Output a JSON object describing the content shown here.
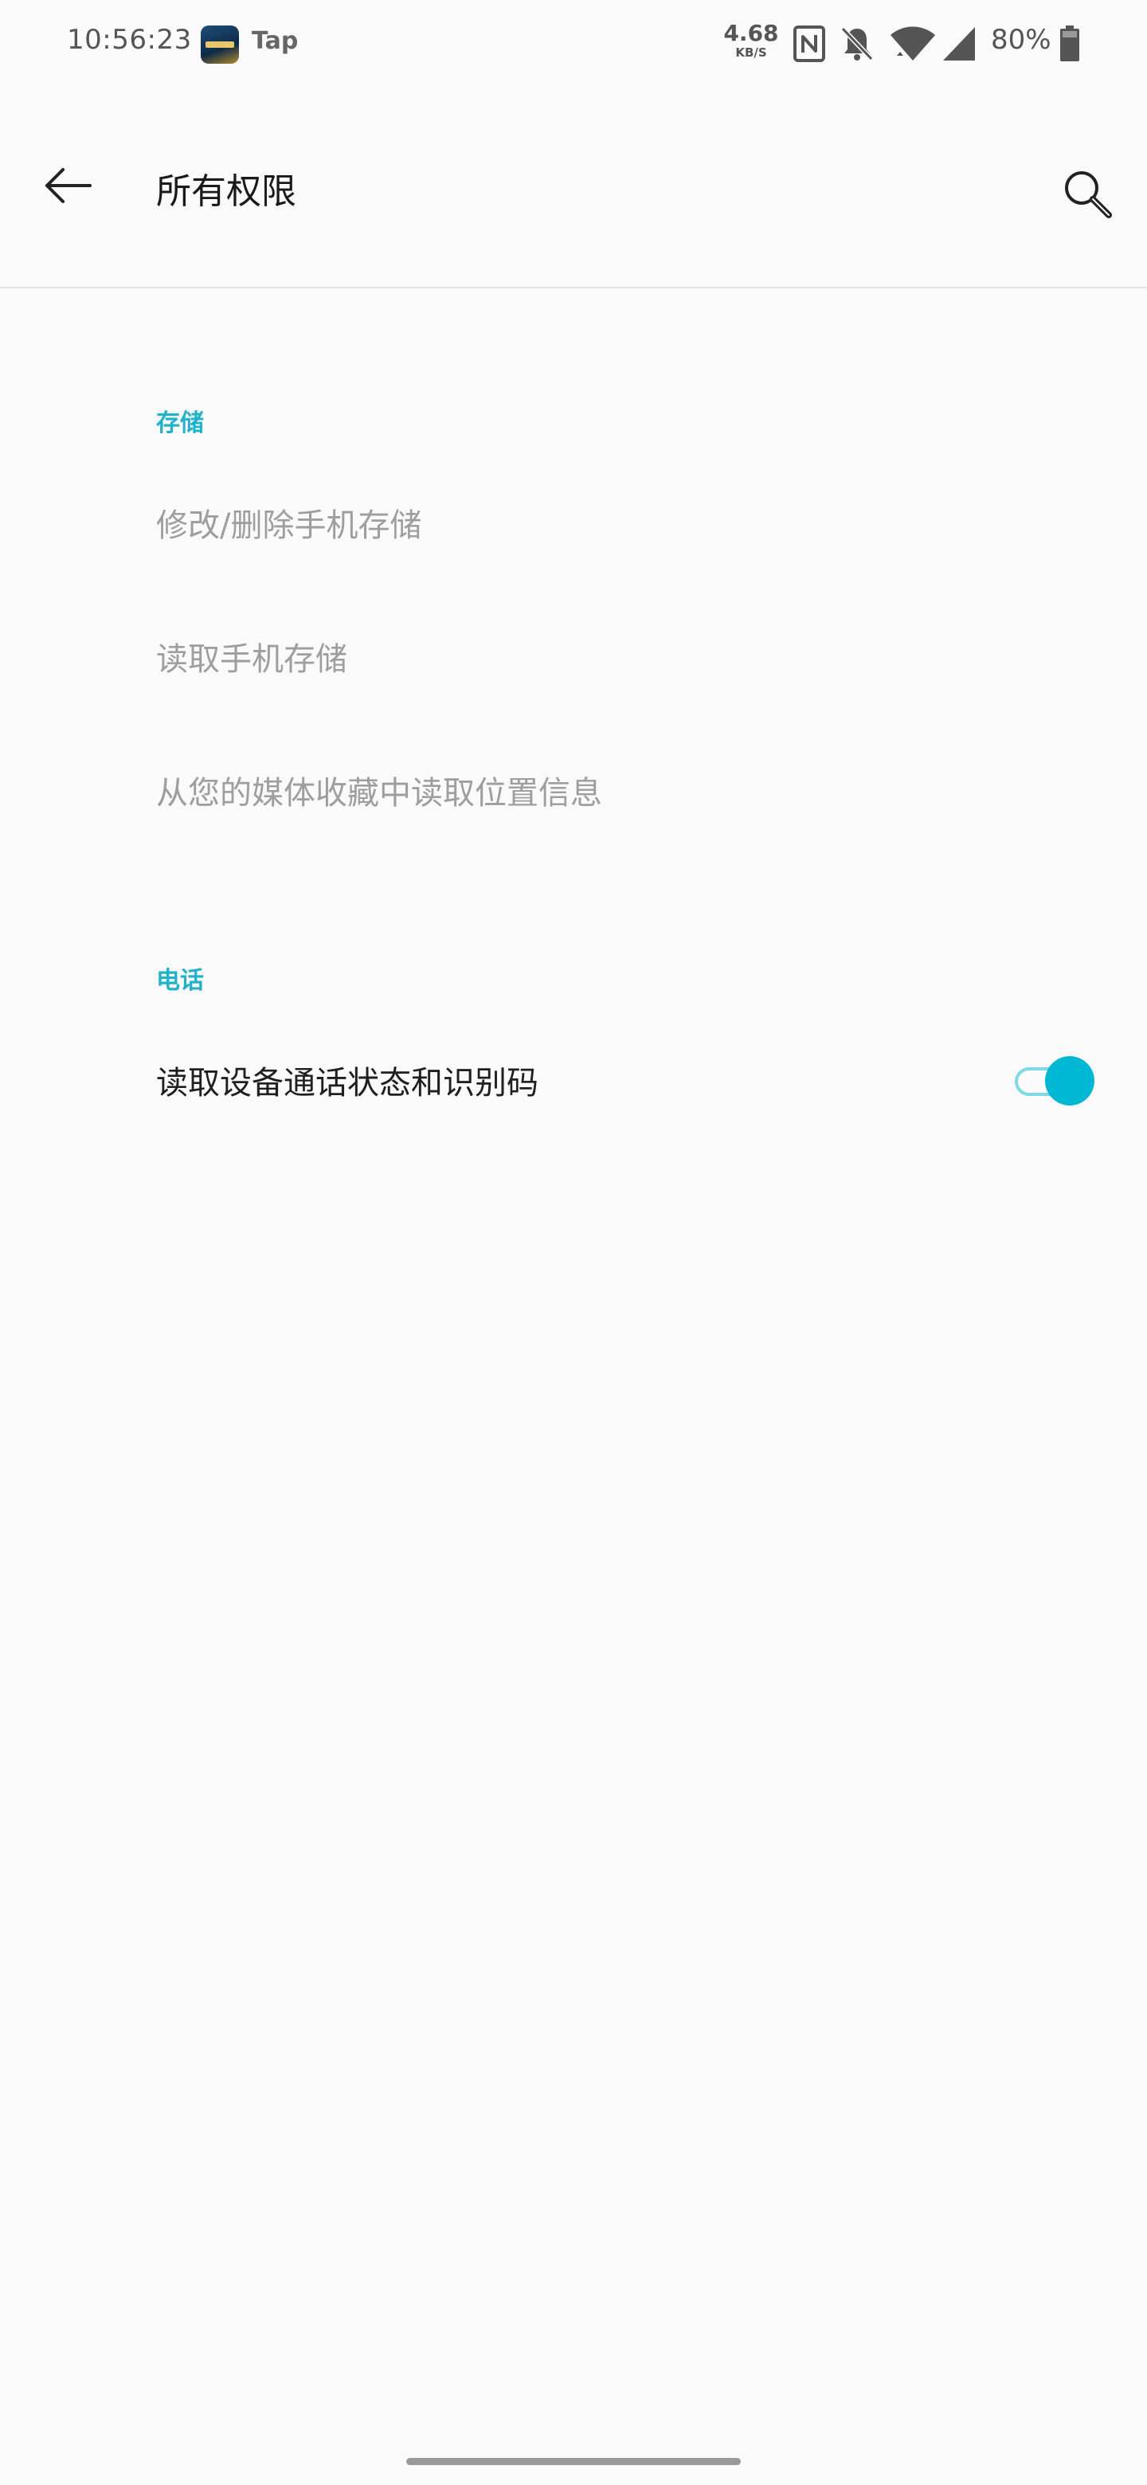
{
  "status_bar": {
    "time": "10:56:23",
    "notification_label": "Tap",
    "net_speed_value": "4.68",
    "net_speed_unit": "KB/S",
    "battery_percent": "80%",
    "icons": [
      "nfc-icon",
      "bell-off-icon",
      "wifi-icon",
      "cellular-signal-icon",
      "battery-icon"
    ]
  },
  "app_bar": {
    "title": "所有权限",
    "back_icon": "back-arrow-icon",
    "search_icon": "search-icon"
  },
  "sections": [
    {
      "header": "存储",
      "items": [
        {
          "label": "修改/删除手机存储",
          "enabled": false
        },
        {
          "label": "读取手机存储",
          "enabled": false
        },
        {
          "label": "从您的媒体收藏中读取位置信息",
          "enabled": false
        }
      ]
    },
    {
      "header": "电话",
      "items": [
        {
          "label": "读取设备通话状态和识别码",
          "enabled": true,
          "toggle_on": true
        }
      ]
    }
  ],
  "colors": {
    "accent": "#00b8d4",
    "section_header": "#1fb2c8",
    "background": "#fafafa"
  }
}
